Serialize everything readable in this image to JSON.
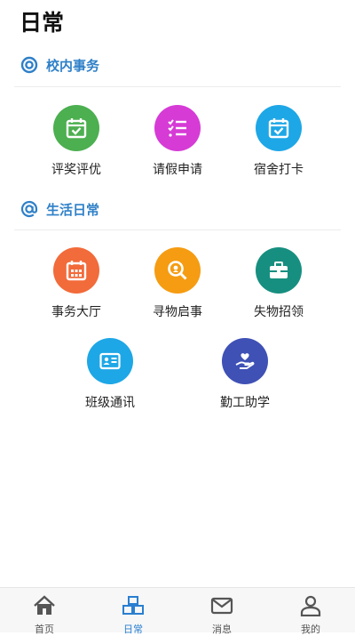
{
  "header": {
    "title": "日常"
  },
  "sections": [
    {
      "title": "校内事务",
      "icon": "target-icon",
      "items": [
        {
          "label": "评奖评优",
          "icon": "calendar-check-icon",
          "color": "#4caf50"
        },
        {
          "label": "请假申请",
          "icon": "checklist-icon",
          "color": "#d63bd6"
        },
        {
          "label": "宿舍打卡",
          "icon": "calendar-check-icon",
          "color": "#1ea7e6"
        }
      ]
    },
    {
      "title": "生活日常",
      "icon": "at-icon",
      "items": [
        {
          "label": "事务大厅",
          "icon": "calendar-grid-icon",
          "color": "#f26b3a"
        },
        {
          "label": "寻物启事",
          "icon": "search-location-icon",
          "color": "#f59c12"
        },
        {
          "label": "失物招领",
          "icon": "briefcase-icon",
          "color": "#178f80"
        },
        {
          "label": "班级通讯",
          "icon": "id-card-icon",
          "color": "#1ea7e6"
        },
        {
          "label": "勤工助学",
          "icon": "hand-heart-icon",
          "color": "#3f51b5"
        }
      ]
    }
  ],
  "tabbar": {
    "items": [
      {
        "label": "首页",
        "icon": "home-icon",
        "active": false
      },
      {
        "label": "日常",
        "icon": "boxes-icon",
        "active": true
      },
      {
        "label": "消息",
        "icon": "mail-icon",
        "active": false
      },
      {
        "label": "我的",
        "icon": "user-icon",
        "active": false
      }
    ]
  },
  "colors": {
    "accent": "#2f80c8",
    "tab_active": "#2a7fd0",
    "tab_inactive": "#555555"
  }
}
